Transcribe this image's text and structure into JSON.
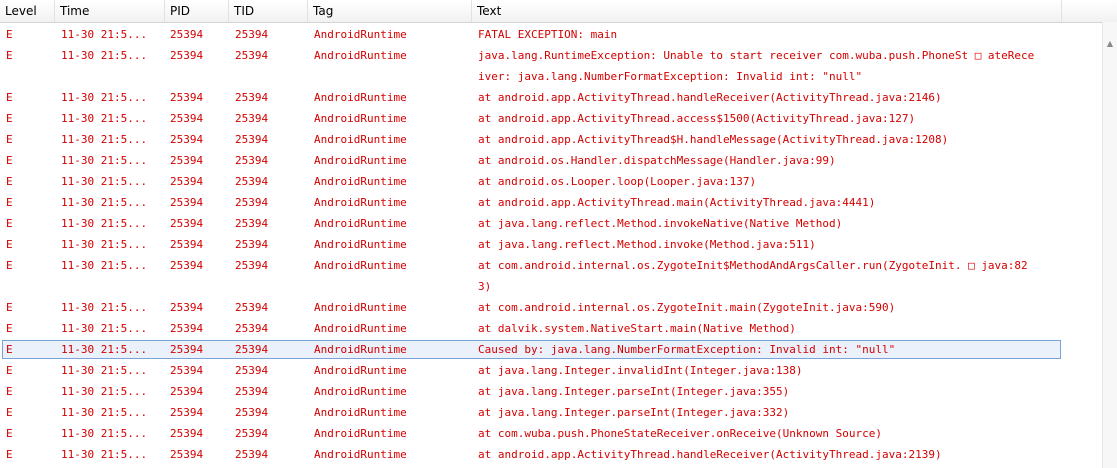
{
  "columns": [
    "Level",
    "Time",
    "PID",
    "TID",
    "Tag",
    "Text"
  ],
  "rows": [
    {
      "level": "E",
      "time": "11-30 21:5...",
      "pid": "25394",
      "tid": "25394",
      "tag": "AndroidRuntime",
      "text": "FATAL EXCEPTION: main"
    },
    {
      "level": "E",
      "time": "11-30 21:5...",
      "pid": "25394",
      "tid": "25394",
      "tag": "AndroidRuntime",
      "text": "java.lang.RuntimeException: Unable to start receiver com.wuba.push.PhoneSt □ ateReceiver: java.lang.NumberFormatException: Invalid int: \"null\""
    },
    {
      "level": "E",
      "time": "11-30 21:5...",
      "pid": "25394",
      "tid": "25394",
      "tag": "AndroidRuntime",
      "text": "at android.app.ActivityThread.handleReceiver(ActivityThread.java:2146)"
    },
    {
      "level": "E",
      "time": "11-30 21:5...",
      "pid": "25394",
      "tid": "25394",
      "tag": "AndroidRuntime",
      "text": "at android.app.ActivityThread.access$1500(ActivityThread.java:127)"
    },
    {
      "level": "E",
      "time": "11-30 21:5...",
      "pid": "25394",
      "tid": "25394",
      "tag": "AndroidRuntime",
      "text": "at android.app.ActivityThread$H.handleMessage(ActivityThread.java:1208)"
    },
    {
      "level": "E",
      "time": "11-30 21:5...",
      "pid": "25394",
      "tid": "25394",
      "tag": "AndroidRuntime",
      "text": "at android.os.Handler.dispatchMessage(Handler.java:99)"
    },
    {
      "level": "E",
      "time": "11-30 21:5...",
      "pid": "25394",
      "tid": "25394",
      "tag": "AndroidRuntime",
      "text": "at android.os.Looper.loop(Looper.java:137)"
    },
    {
      "level": "E",
      "time": "11-30 21:5...",
      "pid": "25394",
      "tid": "25394",
      "tag": "AndroidRuntime",
      "text": "at android.app.ActivityThread.main(ActivityThread.java:4441)"
    },
    {
      "level": "E",
      "time": "11-30 21:5...",
      "pid": "25394",
      "tid": "25394",
      "tag": "AndroidRuntime",
      "text": "at java.lang.reflect.Method.invokeNative(Native Method)"
    },
    {
      "level": "E",
      "time": "11-30 21:5...",
      "pid": "25394",
      "tid": "25394",
      "tag": "AndroidRuntime",
      "text": "at java.lang.reflect.Method.invoke(Method.java:511)"
    },
    {
      "level": "E",
      "time": "11-30 21:5...",
      "pid": "25394",
      "tid": "25394",
      "tag": "AndroidRuntime",
      "text": "at com.android.internal.os.ZygoteInit$MethodAndArgsCaller.run(ZygoteInit. □ java:823)"
    },
    {
      "level": "E",
      "time": "11-30 21:5...",
      "pid": "25394",
      "tid": "25394",
      "tag": "AndroidRuntime",
      "text": "at com.android.internal.os.ZygoteInit.main(ZygoteInit.java:590)"
    },
    {
      "level": "E",
      "time": "11-30 21:5...",
      "pid": "25394",
      "tid": "25394",
      "tag": "AndroidRuntime",
      "text": "at dalvik.system.NativeStart.main(Native Method)"
    },
    {
      "level": "E",
      "time": "11-30 21:5...",
      "pid": "25394",
      "tid": "25394",
      "tag": "AndroidRuntime",
      "text": "Caused by: java.lang.NumberFormatException: Invalid int: \"null\""
    },
    {
      "level": "E",
      "time": "11-30 21:5...",
      "pid": "25394",
      "tid": "25394",
      "tag": "AndroidRuntime",
      "text": "at java.lang.Integer.invalidInt(Integer.java:138)"
    },
    {
      "level": "E",
      "time": "11-30 21:5...",
      "pid": "25394",
      "tid": "25394",
      "tag": "AndroidRuntime",
      "text": "at java.lang.Integer.parseInt(Integer.java:355)"
    },
    {
      "level": "E",
      "time": "11-30 21:5...",
      "pid": "25394",
      "tid": "25394",
      "tag": "AndroidRuntime",
      "text": "at java.lang.Integer.parseInt(Integer.java:332)"
    },
    {
      "level": "E",
      "time": "11-30 21:5...",
      "pid": "25394",
      "tid": "25394",
      "tag": "AndroidRuntime",
      "text": "at com.wuba.push.PhoneStateReceiver.onReceive(Unknown Source)"
    },
    {
      "level": "E",
      "time": "11-30 21:5...",
      "pid": "25394",
      "tid": "25394",
      "tag": "AndroidRuntime",
      "text": "at android.app.ActivityThread.handleReceiver(ActivityThread.java:2139)"
    }
  ],
  "selected_row": 13,
  "colors": {
    "error_text": "#d40000",
    "selection_border": "#7aa3d8",
    "selection_bg": "#eaf1fb"
  },
  "icons": {
    "scroll_up": "chevron-up-icon"
  }
}
